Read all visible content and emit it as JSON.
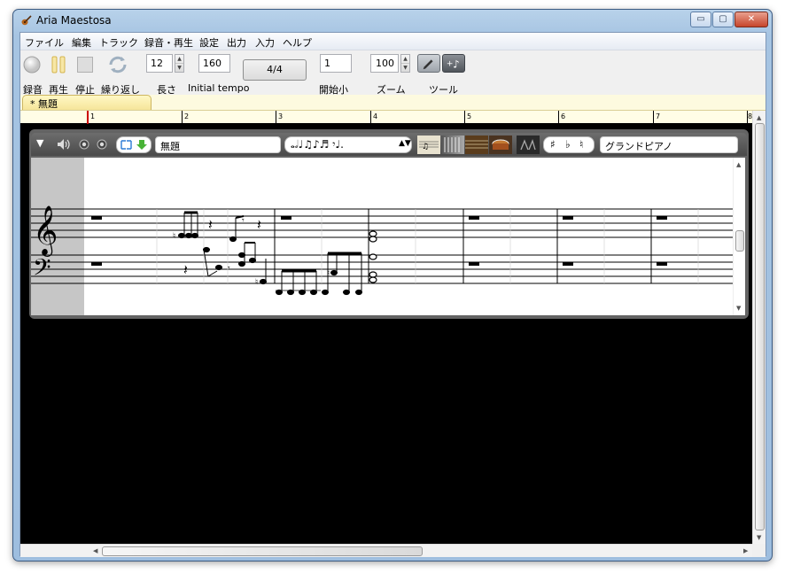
{
  "window": {
    "title": "Aria Maestosa",
    "minimize": "▭",
    "maximize": "▢",
    "close": "✕"
  },
  "menu": [
    "ファイル",
    "編集",
    "トラック",
    "録音・再生",
    "設定",
    "出力",
    "入力",
    "ヘルプ"
  ],
  "toolbar": {
    "record_label": "録音",
    "play_label": "再生",
    "stop_label": "停止",
    "loop_label": "繰り返し",
    "length_value": "12",
    "length_label": "長さ",
    "tempo_value": "160",
    "tempo_label": "Initial tempo",
    "time_signature": "4/4",
    "start_value": "1",
    "start_label": "開始小",
    "zoom_value": "100",
    "zoom_label": "ズーム",
    "tools_label": "ツール",
    "tool_pencil_icon": "pencil-icon",
    "tool_note_icon": "add-note-icon"
  },
  "tab": {
    "label": "* 無題"
  },
  "ruler": {
    "measures": [
      "1",
      "2",
      "3",
      "4",
      "5",
      "6",
      "7",
      "8"
    ]
  },
  "track": {
    "collapse_icon": "triangle-down-icon",
    "name": "無題",
    "instrument": "グランドピアノ",
    "duration_symbols": "𝅝𝅗𝅥♩♫♪♬ 𝄾♩.",
    "accidentals": {
      "sharp": "♯",
      "flat": "♭",
      "natural": "♮"
    }
  },
  "colors": {
    "accent": "#f0c34a",
    "canvas": "#000000",
    "track": "#5a5a5a"
  }
}
